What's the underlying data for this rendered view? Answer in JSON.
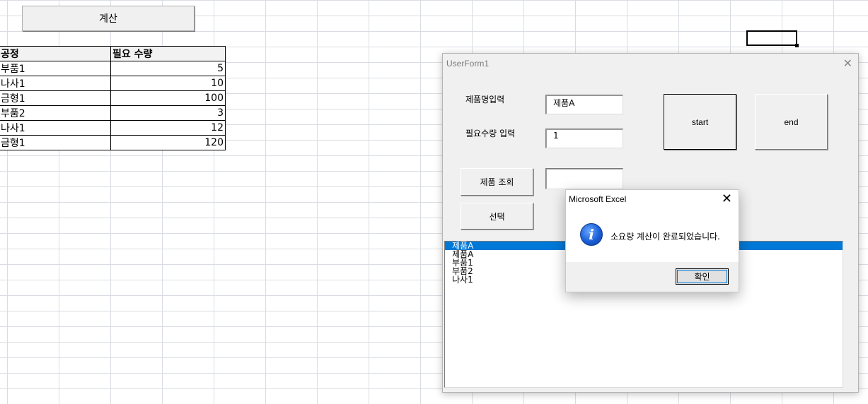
{
  "sheet": {
    "calc_button": "계산",
    "headers": [
      "공정",
      "필요 수량"
    ],
    "rows": [
      {
        "name": "부품1",
        "qty": "5"
      },
      {
        "name": "나사1",
        "qty": "10"
      },
      {
        "name": "금형1",
        "qty": "100"
      },
      {
        "name": "부품2",
        "qty": "3"
      },
      {
        "name": "나사1",
        "qty": "12"
      },
      {
        "name": "금형1",
        "qty": "120"
      }
    ]
  },
  "userform": {
    "title": "UserForm1",
    "product_label": "제품명입력",
    "product_value": "제품A",
    "qty_label": "필요수량 입력",
    "qty_value": "1",
    "lookup_button": "제품 조회",
    "lookup_value": "",
    "select_button": "선택",
    "start_button": "start",
    "end_button": "end",
    "list_items": [
      "제품A",
      "제품A",
      "부품1",
      "부품2",
      "나사1"
    ],
    "selected_index": 0
  },
  "msgbox": {
    "title": "Microsoft Excel",
    "message": "소요량 계산이 완료되었습니다.",
    "ok_button": "확인",
    "icon": "info-icon"
  },
  "colors": {
    "selection": "#0078d7",
    "gridline": "#d9dde3",
    "form_bg": "#f0f0f0"
  }
}
